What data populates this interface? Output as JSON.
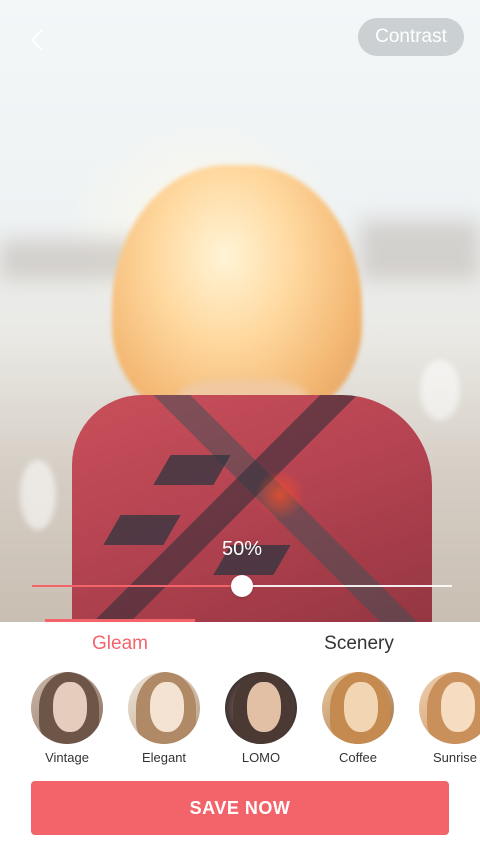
{
  "header": {
    "back_icon": "chevron-left-icon",
    "contrast_label": "Contrast"
  },
  "adjust": {
    "percent_label": "50%",
    "slider_value_fraction": 0.5
  },
  "tabs": [
    {
      "label": "Gleam",
      "active": true
    },
    {
      "label": "Scenery",
      "active": false
    }
  ],
  "filters": [
    {
      "label": "Vintage"
    },
    {
      "label": "Elegant"
    },
    {
      "label": "LOMO"
    },
    {
      "label": "Coffee"
    },
    {
      "label": "Sunrise"
    }
  ],
  "save_label": "SAVE NOW",
  "colors": {
    "accent": "#f3646a",
    "tab_inactive": "#333333",
    "panel_bg": "#ffffff"
  }
}
